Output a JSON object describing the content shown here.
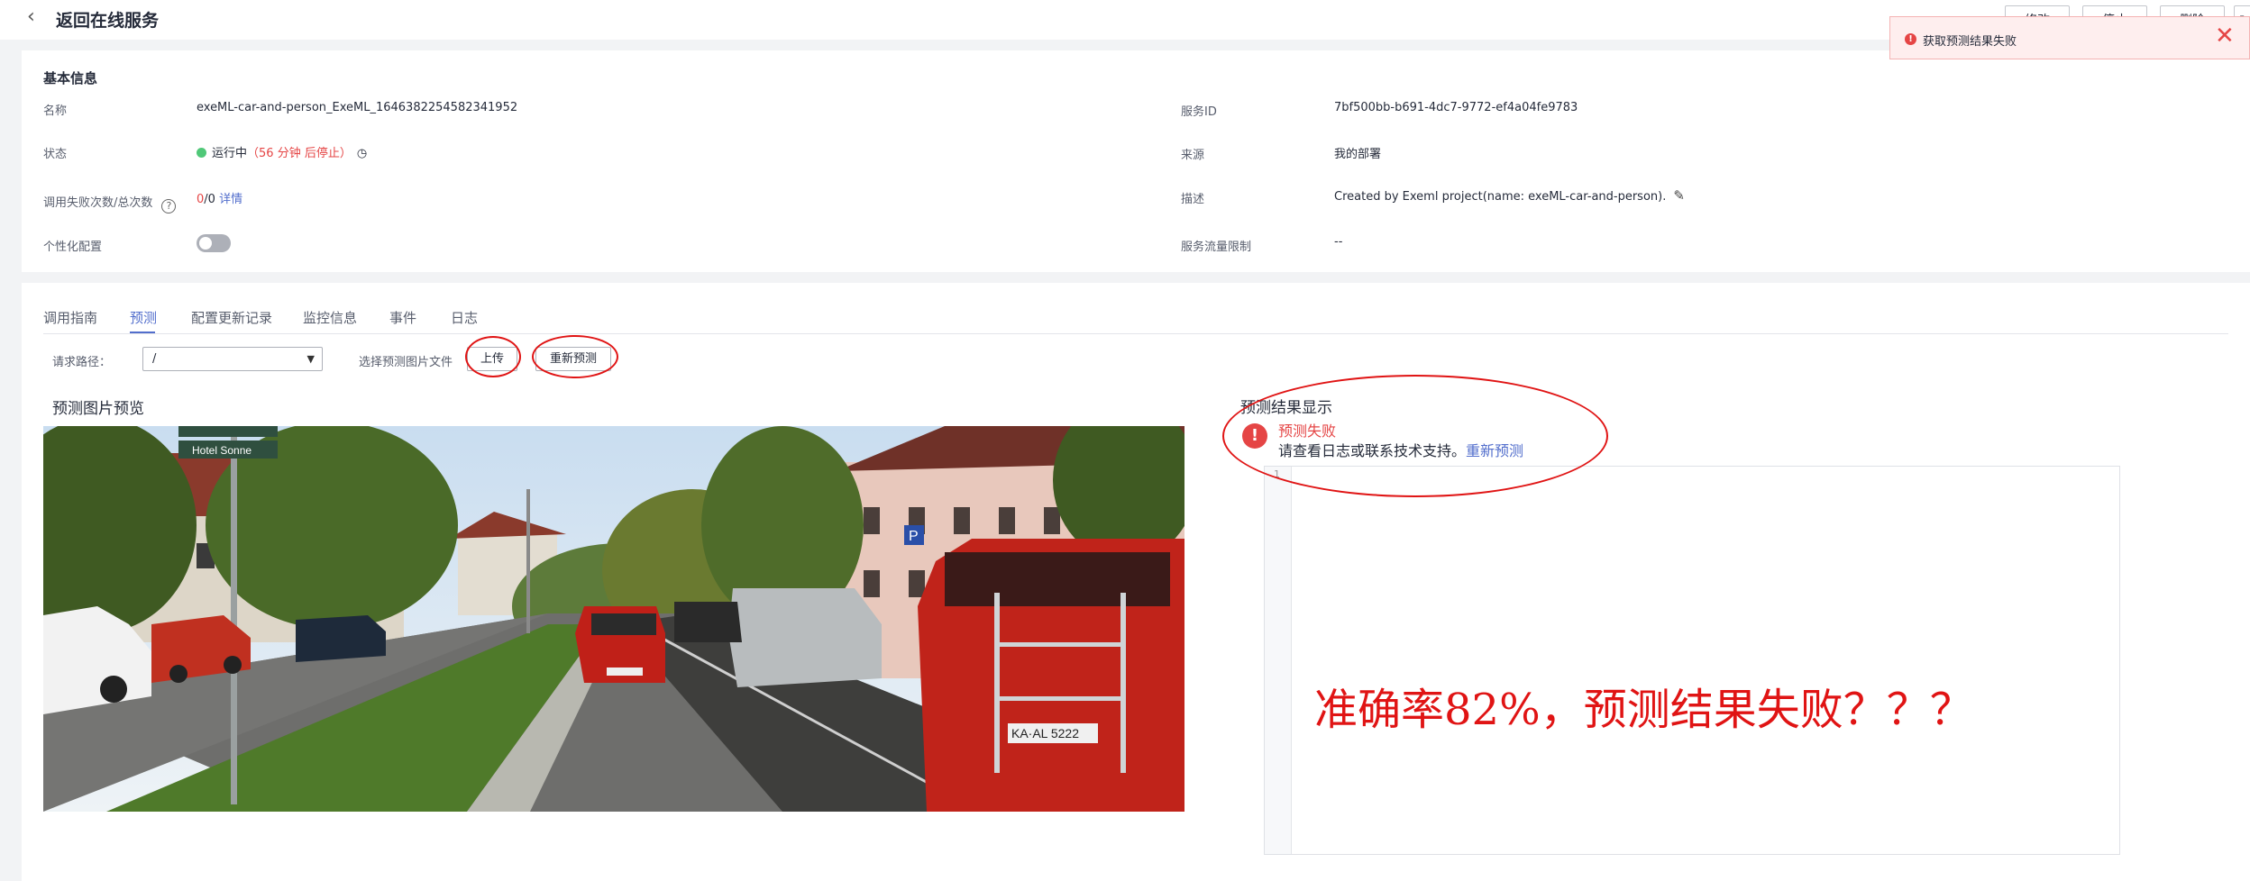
{
  "header": {
    "title": "返回在线服务",
    "buttons": [
      "修改",
      "停止",
      "删除"
    ]
  },
  "toast": {
    "message": "获取预测结果失败"
  },
  "basic_info": {
    "section_title": "基本信息",
    "name_label": "名称",
    "name_value": "exeML-car-and-person_ExeML_1646382254582341952",
    "status_label": "状态",
    "status_value": "运行中",
    "status_remaining": "（56 分钟 后停止）",
    "calls_label": "调用失败次数/总次数",
    "calls_failed": "0",
    "calls_sep": "/",
    "calls_total": "0",
    "calls_detail_link": "详情",
    "personal_label": "个性化配置",
    "service_id_label": "服务ID",
    "service_id_value": "7bf500bb-b691-4dc7-9772-ef4a04fe9783",
    "source_label": "来源",
    "source_value": "我的部署",
    "desc_label": "描述",
    "desc_value": "Created by Exeml project(name: exeML-car-and-person).",
    "flow_limit_label": "服务流量限制",
    "flow_limit_value": "--"
  },
  "tabs": [
    "调用指南",
    "预测",
    "配置更新记录",
    "监控信息",
    "事件",
    "日志"
  ],
  "predict": {
    "path_label": "请求路径：",
    "path_value": "/",
    "file_label": "选择预测图片文件",
    "upload_button": "上传",
    "repredict_button": "重新预测",
    "preview_title": "预测图片预览",
    "street_sign_1": "Hotel Sonne",
    "plate_text": "KA·AL 5222",
    "parking_sign": "P",
    "result_title": "预测结果显示",
    "fail_title": "预测失败",
    "fail_desc": "请查看日志或联系技术支持。",
    "fail_repredict_link": "重新预测",
    "gutter_line": "1"
  },
  "annotation": {
    "text": "准确率82%，预测结果失败？？？"
  },
  "colors": {
    "accent": "#526ecc",
    "error": "#e54545",
    "annotation": "#e01414",
    "status_ok": "#50c878"
  }
}
